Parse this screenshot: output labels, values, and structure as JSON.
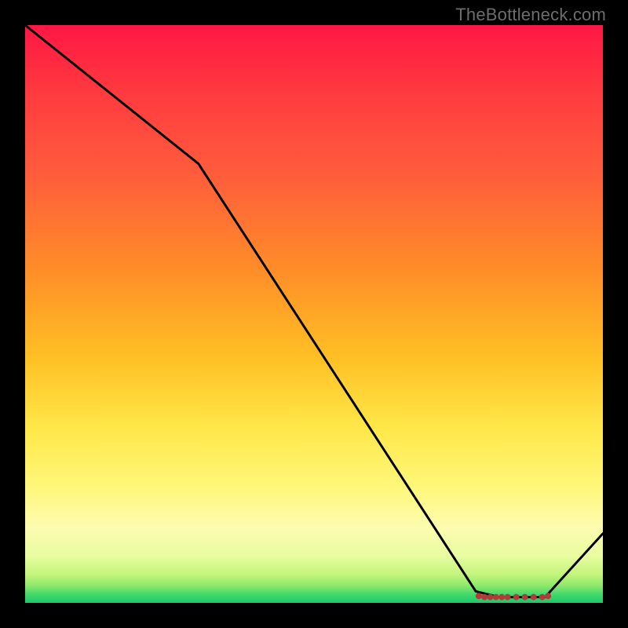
{
  "watermark": "TheBottleneck.com",
  "chart_data": {
    "type": "line",
    "title": "",
    "xlabel": "",
    "ylabel": "",
    "xlim": [
      0,
      100
    ],
    "ylim": [
      0,
      100
    ],
    "series": [
      {
        "name": "bottleneck-curve",
        "x": [
          0,
          30,
          78,
          82,
          86,
          90,
          100
        ],
        "y": [
          100,
          76,
          2,
          1,
          1,
          1,
          12
        ]
      }
    ],
    "markers": {
      "name": "flat-region-dots",
      "x": [
        78.5,
        79.5,
        80.5,
        81.5,
        82.5,
        83.5,
        85.0,
        86.5,
        88.0,
        89.5,
        90.5
      ],
      "y": [
        1.2,
        1.0,
        1.0,
        1.0,
        1.0,
        1.0,
        1.0,
        1.0,
        1.0,
        1.0,
        1.2
      ]
    },
    "colors": {
      "line": "#000000",
      "marker": "#b23a3a",
      "gradient_top": "#ff1744",
      "gradient_bottom": "#19c96a",
      "frame": "#000000"
    }
  }
}
